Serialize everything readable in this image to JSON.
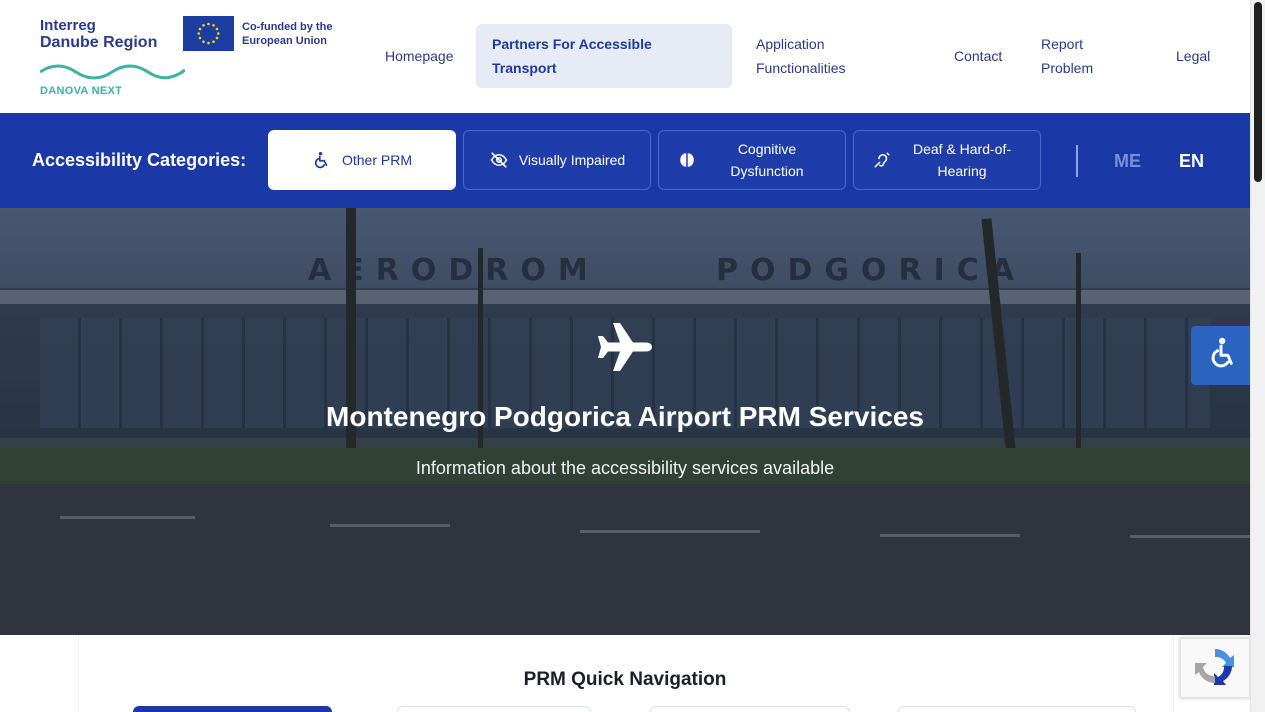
{
  "header": {
    "logo": {
      "line1": "Interreg",
      "line2": "Danube Region",
      "eu_text": "Co-funded by the European Union",
      "project": "DANOVA NEXT"
    },
    "nav": [
      {
        "label": "Homepage"
      },
      {
        "label": "Partners For Accessible Transport",
        "active": true
      },
      {
        "label": "Application Functionalities"
      },
      {
        "label": "Contact"
      },
      {
        "label": "Report Problem"
      },
      {
        "label": "Legal"
      }
    ]
  },
  "categories": {
    "title": "Accessibility Categories:",
    "items": [
      {
        "label": "Other PRM",
        "icon": "wheelchair-icon",
        "active": true
      },
      {
        "label": "Visually Impaired",
        "icon": "eye-slash-icon"
      },
      {
        "label": "Cognitive Dysfunction",
        "icon": "brain-icon"
      },
      {
        "label": "Deaf & Hard-of-Hearing",
        "icon": "ear-deaf-icon"
      }
    ],
    "languages": [
      {
        "label": "ME",
        "active": false
      },
      {
        "label": "EN",
        "active": true
      }
    ]
  },
  "hero": {
    "icon": "airplane-icon",
    "sign_left": "AERODROM",
    "sign_right": "PODGORICA",
    "title": "Montenegro Podgorica Airport PRM Services",
    "subtitle": "Information about the accessibility services available"
  },
  "quick_nav": {
    "title": "PRM Quick Navigation"
  },
  "floating": {
    "accessibility_icon": "accessibility-icon",
    "recaptcha_icon": "recaptcha-icon"
  },
  "colors": {
    "primary": "#1b39a6",
    "nav_active_bg": "#e6ebf6",
    "brand_text": "#2b3a8f",
    "fab": "#2b63c0"
  }
}
